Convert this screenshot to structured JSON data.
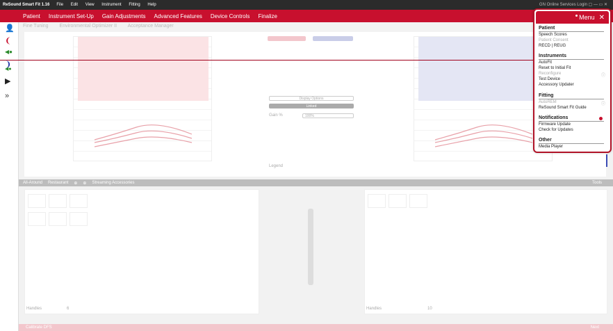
{
  "titlebar": {
    "app": "ReSound Smart Fit 1.16",
    "menus": [
      "File",
      "Edit",
      "View",
      "Instrument",
      "Fitting",
      "Help"
    ],
    "right": "GN Online Services Login ▢ — ▭ ✕"
  },
  "navbar": {
    "items": [
      "Patient",
      "Instrument Set-Up",
      "Gain Adjustments",
      "Advanced Features",
      "Device Controls",
      "Finalize"
    ]
  },
  "subtabs": [
    "Fine Tuning",
    "Environmental Optimizer II",
    "Acceptance Manager"
  ],
  "center": {
    "display_options": "Display Options",
    "linked": "Linked",
    "gain_label": "Gain %",
    "gain_value": "100%",
    "legend": "Legend"
  },
  "programbar": {
    "items": [
      "All-Around",
      "Restaurant",
      "⊕",
      "⊕",
      "Streaming Accessories"
    ],
    "tools": "Tools"
  },
  "handles": {
    "label": "Handles",
    "left_val": "6",
    "right_val": "10"
  },
  "bottombar": {
    "left": "Calibrate DFS",
    "right": "Next"
  },
  "menu": {
    "title": "Menu",
    "sections": [
      {
        "heading": "Patient",
        "items": [
          {
            "label": "Speech Scores",
            "disabled": false
          },
          {
            "label": "Patient Consent",
            "disabled": true
          },
          {
            "label": "REC​D | REUG",
            "disabled": false
          }
        ]
      },
      {
        "heading": "Instruments",
        "items": [
          {
            "label": "AutoFit",
            "disabled": false
          },
          {
            "label": "Reset to Initial Fit",
            "disabled": false
          },
          {
            "label": "Reconfigure",
            "disabled": true
          },
          {
            "label": "Test Device",
            "disabled": false
          },
          {
            "label": "Accessory Updater",
            "disabled": false
          }
        ]
      },
      {
        "heading": "Fitting",
        "items": [
          {
            "label": "AutoREM",
            "disabled": true
          },
          {
            "label": "ReSound Smart Fit Guide",
            "disabled": false
          }
        ]
      },
      {
        "heading": "Notifications",
        "items": [
          {
            "label": "Firmware Update",
            "disabled": false
          },
          {
            "label": "Check for Updates",
            "disabled": false
          }
        ]
      },
      {
        "heading": "Other",
        "items": [
          {
            "label": "Media Player",
            "disabled": false
          }
        ]
      }
    ]
  },
  "colors": {
    "brand": "#c8102e",
    "accent_blue": "#3a4bb5"
  }
}
